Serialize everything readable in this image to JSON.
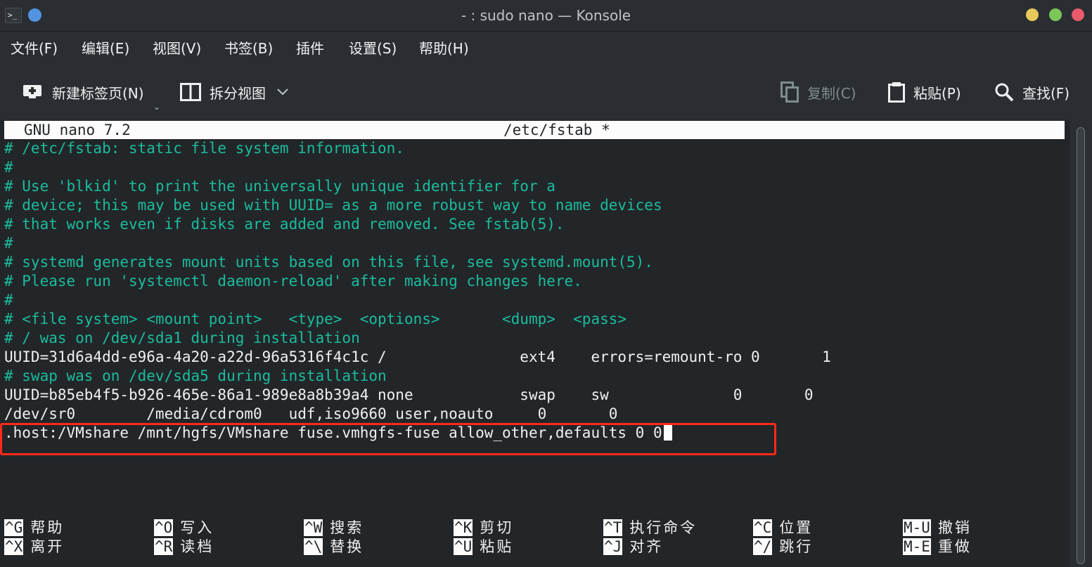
{
  "window": {
    "title": "- : sudo nano — Konsole"
  },
  "menu": [
    "文件(F)",
    "编辑(E)",
    "视图(V)",
    "书签(B)",
    "插件",
    "设置(S)",
    "帮助(H)"
  ],
  "toolbar": {
    "new_tab": "新建标签页(N)",
    "split_view": "拆分视图",
    "copy": "复制(C)",
    "paste": "粘贴(P)",
    "find": "查找(F)"
  },
  "nano": {
    "version": "GNU nano 7.2",
    "filename": "/etc/fstab *",
    "lines": [
      "# /etc/fstab: static file system information.",
      "#",
      "# Use 'blkid' to print the universally unique identifier for a",
      "# device; this may be used with UUID= as a more robust way to name devices",
      "# that works even if disks are added and removed. See fstab(5).",
      "#",
      "# systemd generates mount units based on this file, see systemd.mount(5).",
      "# Please run 'systemctl daemon-reload' after making changes here.",
      "#",
      "# <file system> <mount point>   <type>  <options>       <dump>  <pass>",
      "# / was on /dev/sda1 during installation",
      "UUID=31d6a4dd-e96a-4a20-a22d-96a5316f4c1c /               ext4    errors=remount-ro 0       1",
      "# swap was on /dev/sda5 during installation",
      "UUID=b85eb4f5-b926-465e-86a1-989e8a8b39a4 none            swap    sw              0       0",
      "/dev/sr0        /media/cdrom0   udf,iso9660 user,noauto     0       0",
      ".host:/VMshare /mnt/hgfs/VMshare fuse.vmhgfs-fuse allow_other,defaults 0 0"
    ],
    "shortcuts": [
      {
        "key": "^G",
        "label": "帮助"
      },
      {
        "key": "^X",
        "label": "离开"
      },
      {
        "key": "^O",
        "label": "写入"
      },
      {
        "key": "^R",
        "label": "读档"
      },
      {
        "key": "^W",
        "label": "搜索"
      },
      {
        "key": "^\\",
        "label": "替换"
      },
      {
        "key": "^K",
        "label": "剪切"
      },
      {
        "key": "^U",
        "label": "粘贴"
      },
      {
        "key": "^T",
        "label": "执行命令"
      },
      {
        "key": "^J",
        "label": "对齐"
      },
      {
        "key": "^C",
        "label": "位置"
      },
      {
        "key": "^/",
        "label": "跳行"
      },
      {
        "key": "M-U",
        "label": "撤销"
      },
      {
        "key": "M-E",
        "label": "重做"
      }
    ]
  },
  "colors": {
    "comment": "#1abc9c",
    "highlight": "#ff2a1a",
    "background": "#232629"
  }
}
